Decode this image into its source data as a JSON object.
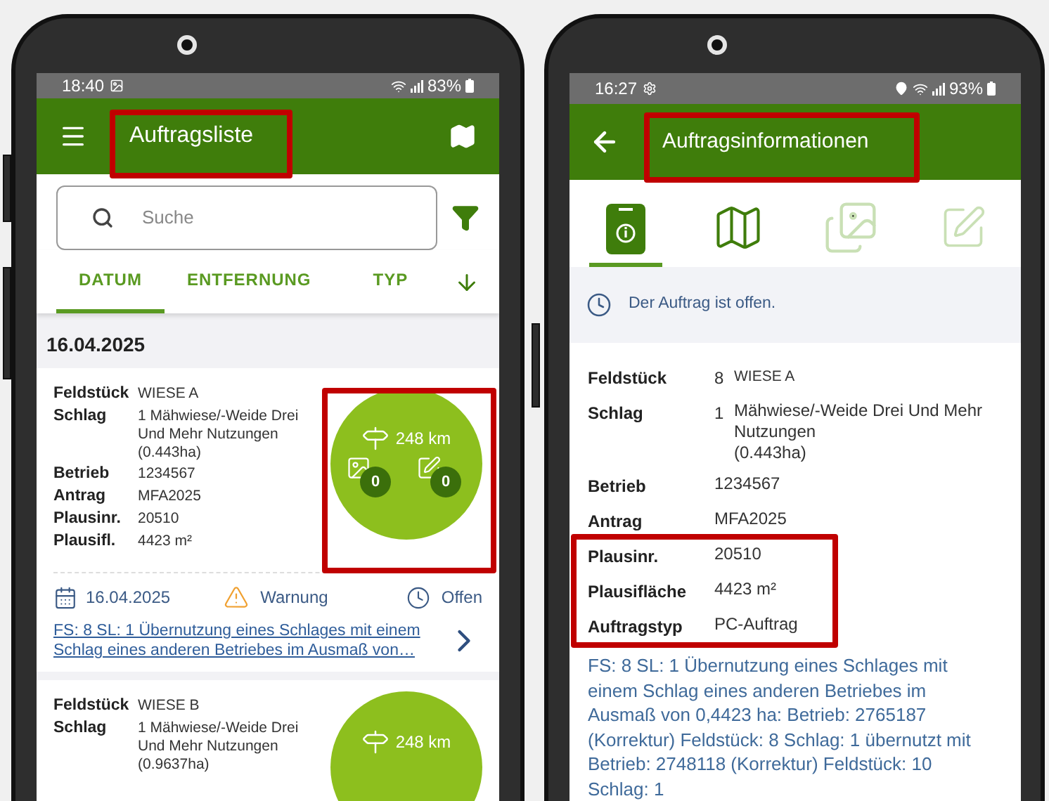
{
  "left_phone": {
    "status_bar": {
      "time": "18:40",
      "battery": "83%"
    },
    "app_bar": {
      "title": "Auftragsliste"
    },
    "search": {
      "placeholder": "Suche"
    },
    "tabs": [
      {
        "label": "DATUM",
        "selected": true
      },
      {
        "label": "ENTFERNUNG",
        "selected": false
      },
      {
        "label": "TYP",
        "selected": false
      }
    ],
    "date_header": "16.04.2025",
    "orders": [
      {
        "fields": [
          {
            "label": "Feldstück",
            "value": "WIESE A"
          },
          {
            "label": "Schlag",
            "value": "1  Mähwiese/-Weide Drei Und Mehr Nutzungen",
            "area": "(0.443ha)"
          },
          {
            "label": "Betrieb",
            "value": "1234567"
          },
          {
            "label": "Antrag",
            "value": "MFA2025"
          },
          {
            "label": "Plausinr.",
            "value": "20510"
          },
          {
            "label": "Plausifl.",
            "value": "4423 m²"
          }
        ],
        "distance": "248 km",
        "photo_count": "0",
        "note_count": "0",
        "date": "16.04.2025",
        "warning": "Warnung",
        "status": "Offen",
        "message": "FS: 8 SL: 1 Übernutzung eines Schlages mit einem Schlag eines anderen Betriebes im Ausmaß von…"
      },
      {
        "fields": [
          {
            "label": "Feldstück",
            "value": "WIESE B"
          },
          {
            "label": "Schlag",
            "value": "1  Mähwiese/-Weide Drei Und Mehr Nutzungen",
            "area": "(0.9637ha)"
          }
        ],
        "distance": "248 km"
      }
    ]
  },
  "right_phone": {
    "status_bar": {
      "time": "16:27",
      "battery": "93%"
    },
    "app_bar": {
      "title": "Auftragsinformationen"
    },
    "icon_tabs": [
      {
        "kind": "info",
        "selected": true,
        "disabled": false
      },
      {
        "kind": "map",
        "selected": false,
        "disabled": false
      },
      {
        "kind": "photos",
        "selected": false,
        "disabled": true
      },
      {
        "kind": "notes",
        "selected": false,
        "disabled": true
      }
    ],
    "status_banner": "Der Auftrag ist offen.",
    "details": [
      {
        "label": "Feldstück",
        "number": "8",
        "value": "WIESE A"
      },
      {
        "label": "Schlag",
        "number": "1",
        "value": "Mähwiese/-Weide Drei Und Mehr Nutzungen",
        "area": "(0.443ha)"
      },
      {
        "label": "Betrieb",
        "value": "1234567"
      },
      {
        "label": "Antrag",
        "value": "MFA2025"
      },
      {
        "label": "Plausinr.",
        "value": "20510"
      },
      {
        "label": "Plausifläche",
        "value": "4423 m²"
      },
      {
        "label": "Auftragstyp",
        "value": "PC-Auftrag"
      }
    ],
    "message": "FS: 8 SL: 1 Übernutzung eines Schlages mit einem Schlag eines anderen Betriebes im Ausmaß von 0,4423 ha: Betrieb: 2765187 (Korrektur) Feldstück: 8 Schlag: 1 übernutzt mit Betrieb: 2748118 (Korrektur) Feldstück: 10 Schlag: 1"
  }
}
